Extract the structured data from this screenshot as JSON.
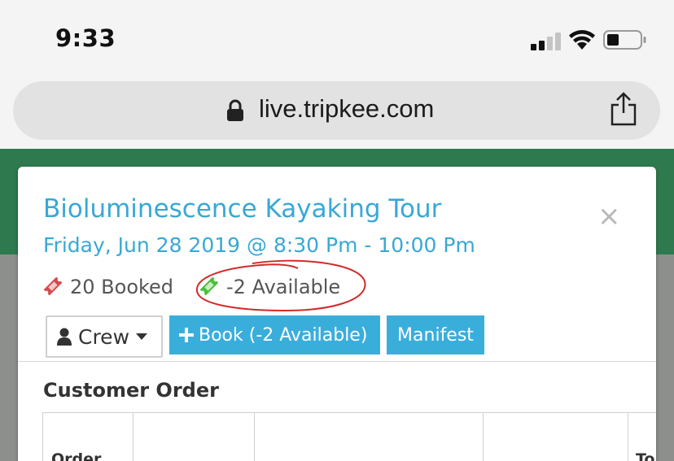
{
  "status_bar": {
    "time": "9:33"
  },
  "browser": {
    "url": "live.tripkee.com"
  },
  "modal": {
    "title": "Bioluminescence Kayaking Tour",
    "datetime": "Friday, Jun 28 2019 @ 8:30 Pm - 10:00 Pm",
    "close_label": "×",
    "stats": {
      "booked": "20 Booked",
      "available": "-2 Available"
    },
    "buttons": {
      "crew": "Crew",
      "book": "Book (-2 Available)",
      "manifest": "Manifest"
    },
    "section_title": "Customer Order",
    "table": {
      "headers": [
        "Order",
        "To"
      ]
    }
  },
  "colors": {
    "accent": "#3aaedb",
    "title_blue": "#38a8d6",
    "header_green": "#2e7a4e",
    "booked_red": "#d24b4b",
    "available_green": "#4bbf3a"
  }
}
